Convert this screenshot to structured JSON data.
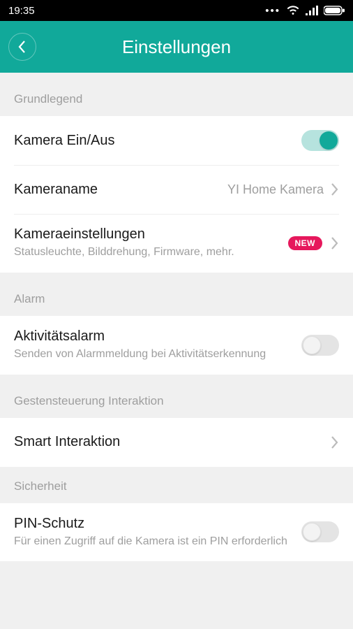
{
  "status": {
    "time": "19:35"
  },
  "header": {
    "title": "Einstellungen"
  },
  "sections": {
    "basic": {
      "label": "Grundlegend",
      "camera_on_off": {
        "title": "Kamera Ein/Aus"
      },
      "camera_name": {
        "title": "Kameraname",
        "value": "YI Home Kamera"
      },
      "camera_settings": {
        "title": "Kameraeinstellungen",
        "sub": "Statusleuchte, Bilddrehung, Firmware, mehr.",
        "badge": "NEW"
      }
    },
    "alarm": {
      "label": "Alarm",
      "activity_alarm": {
        "title": "Aktivitätsalarm",
        "sub": "Senden von Alarmmeldung bei Aktivitätserkennung"
      }
    },
    "gesture": {
      "label": "Gestensteuerung Interaktion",
      "smart": {
        "title": "Smart Interaktion"
      }
    },
    "security": {
      "label": "Sicherheit",
      "pin": {
        "title": "PIN-Schutz",
        "sub": "Für einen Zugriff auf die Kamera ist ein PIN erforderlich"
      }
    }
  },
  "colors": {
    "accent": "#11a99a",
    "badge": "#e6185c"
  }
}
